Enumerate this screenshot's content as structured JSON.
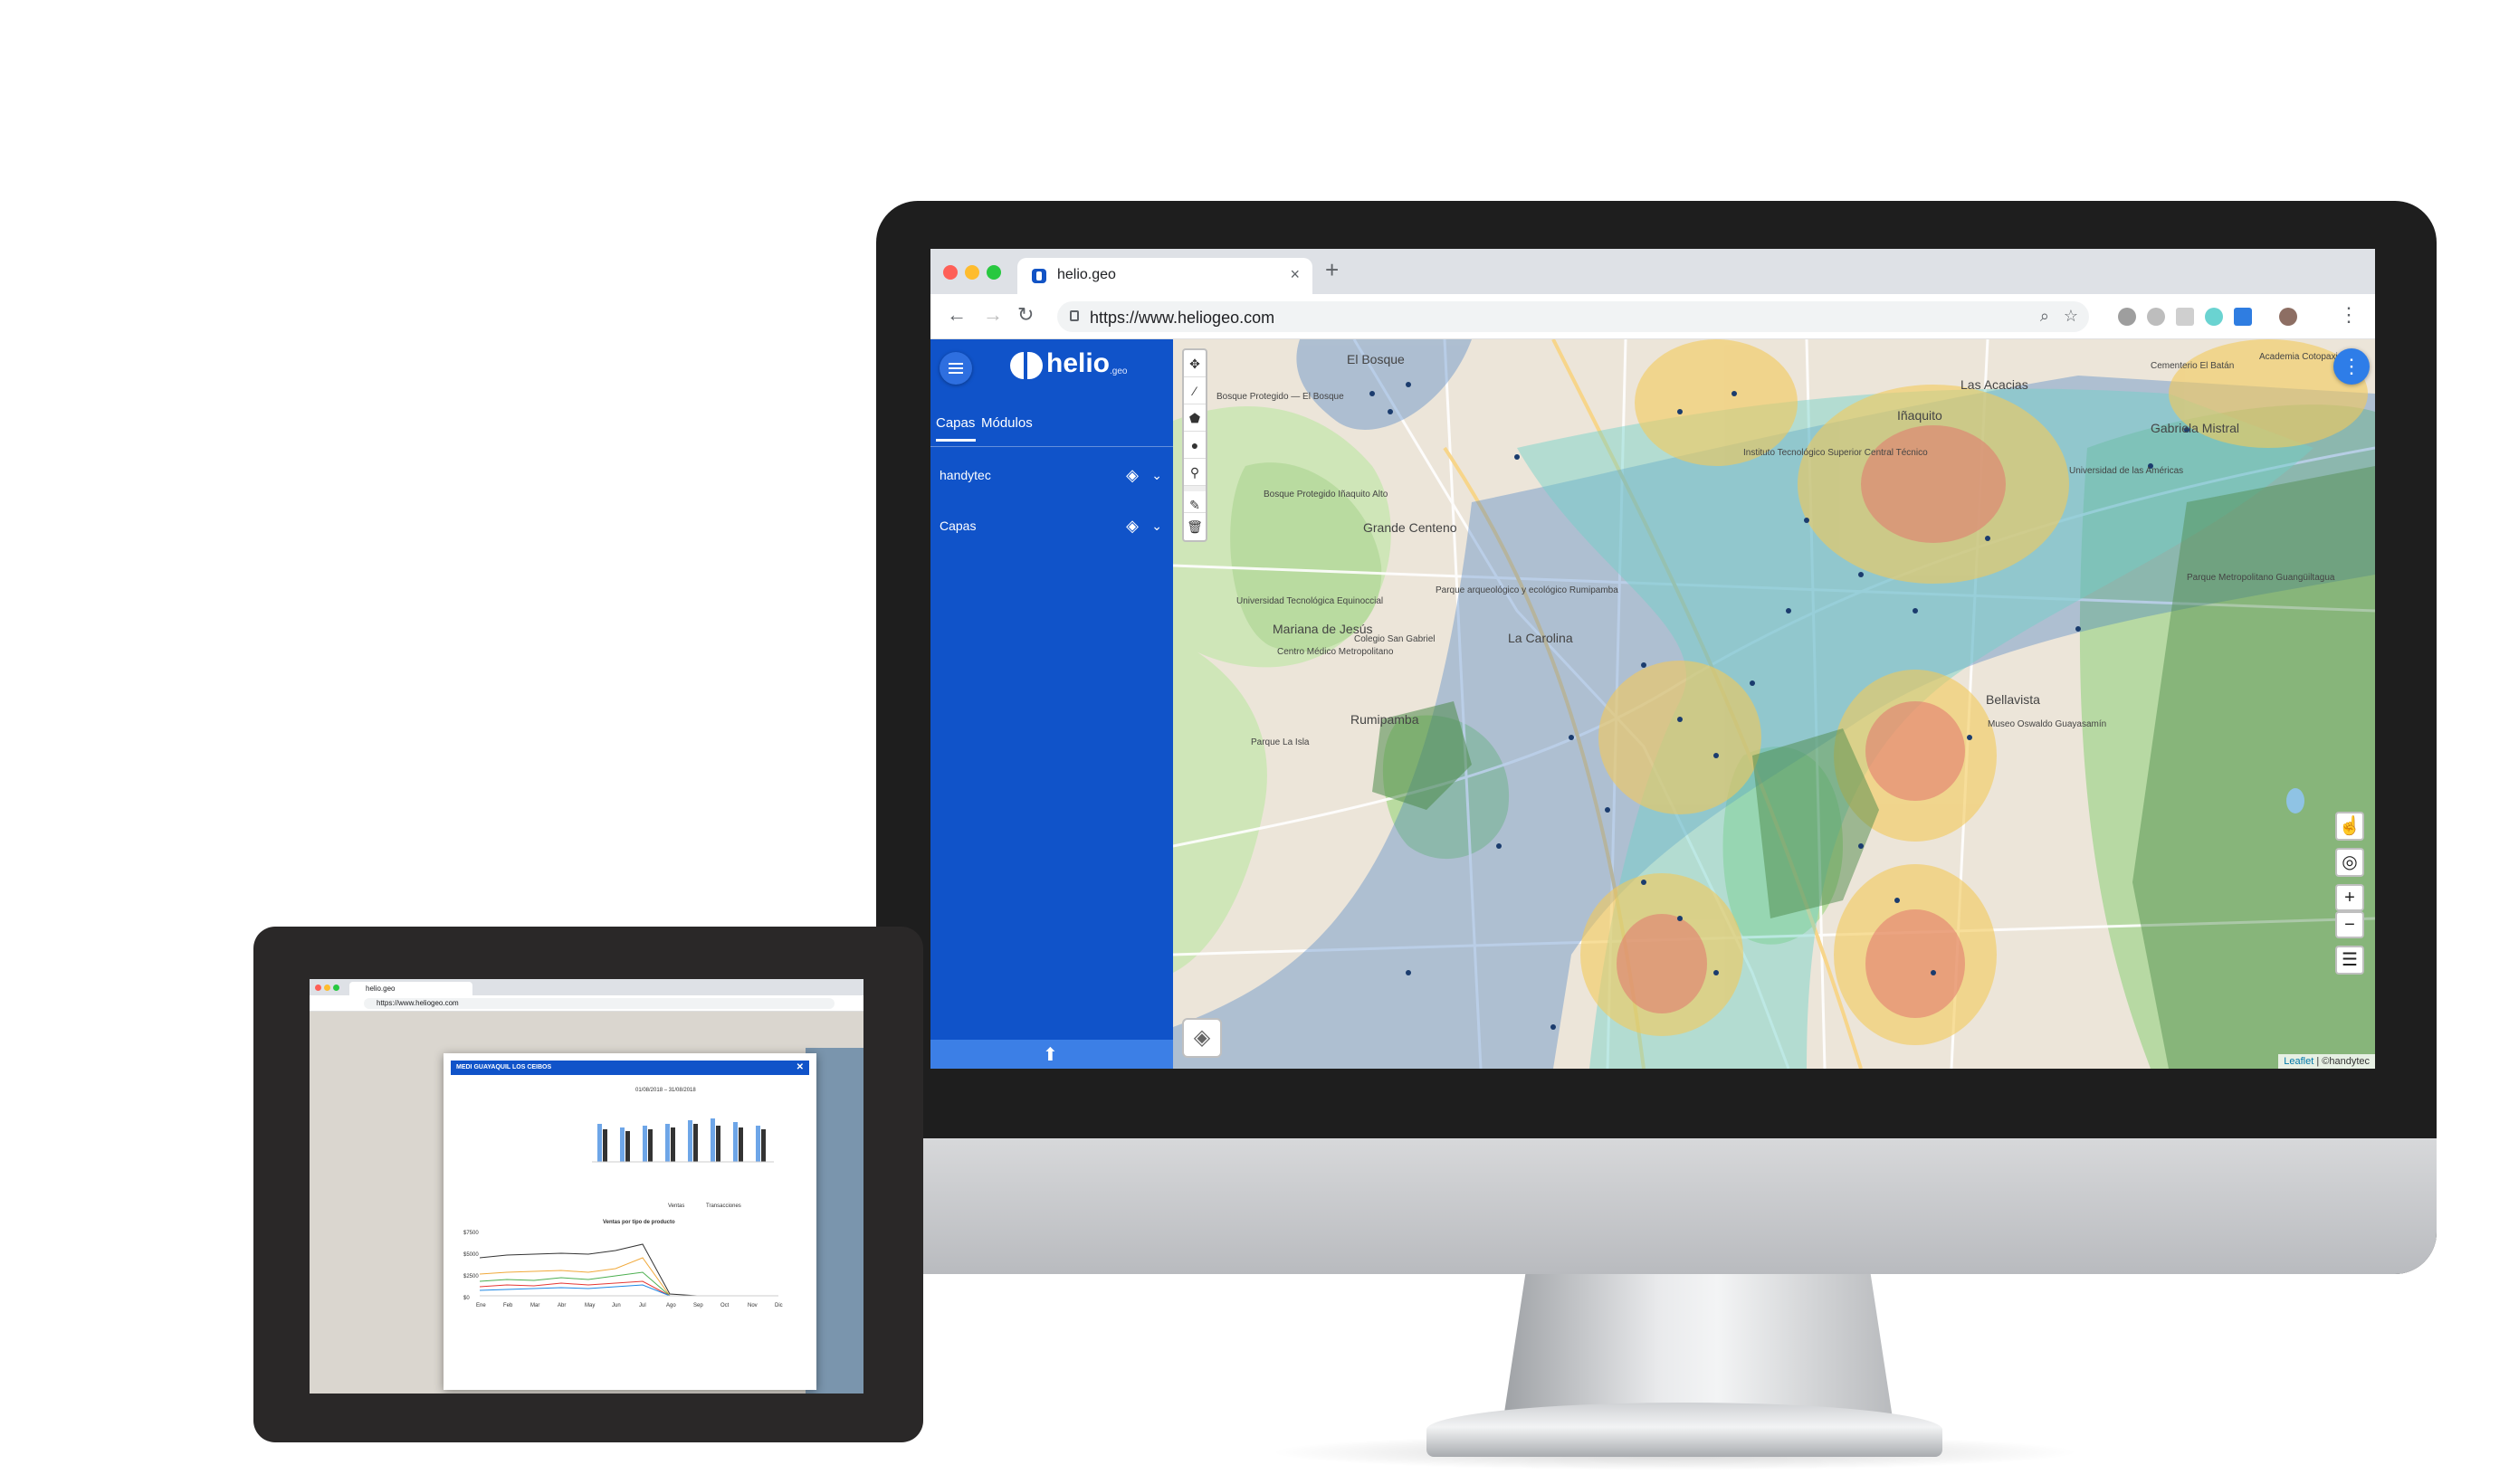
{
  "browser": {
    "tab_title": "helio.geo",
    "new_tab_symbol": "+",
    "close_symbol": "×",
    "url": "https://www.heliogeo.com"
  },
  "app": {
    "logo_text": "helio",
    "logo_sub": ".geo",
    "sidebar_tabs": [
      "Capas",
      "Módulos"
    ],
    "layer_groups": [
      "handytec",
      "Capas"
    ],
    "accent_color": "#1053c9"
  },
  "map": {
    "place_labels": [
      "El Bosque",
      "Bosque Protegido — El Bosque",
      "Bosque Protegido Iñaquito Alto",
      "Iñaquito",
      "Las Acacias",
      "Gabriela Mistral",
      "Grande Centeno",
      "Universidad Tecnológica Equinoccial",
      "Parque arqueológico y ecológico Rumipamba",
      "Mariana de Jesús",
      "Colegio San Gabriel",
      "La Carolina",
      "Centro Médico Metropolitano",
      "Rumipamba",
      "Parque La Isla",
      "Bellavista",
      "Museo Oswaldo Guayasamín",
      "Parque Metropolitano Guangüiltagua",
      "Instituto Tecnológico Superior Central Técnico",
      "Universidad de las Américas",
      "Cementerio El Batán",
      "Academia Cotopaxi"
    ],
    "zoom_in": "+",
    "zoom_out": "−",
    "attribution_link": "Leaflet",
    "attribution_text": "| ©handytec"
  },
  "tablet": {
    "tab_title": "helio.geo",
    "url": "https://www.heliogeo.com",
    "dialog_title": "MEDI GUAYAQUIL LOS CEIBOS",
    "date_range": "01/08/2018 – 31/08/2018",
    "legend": [
      "Ventas",
      "Transacciones"
    ],
    "chart2_title": "Ventas por tipo de producto",
    "y_ticks": [
      "$7500",
      "$5000",
      "$2500",
      "$0"
    ],
    "months": [
      "Ene",
      "Feb",
      "Mar",
      "Abr",
      "May",
      "Jun",
      "Jul",
      "Ago",
      "Sep",
      "Oct",
      "Nov",
      "Dic"
    ]
  }
}
